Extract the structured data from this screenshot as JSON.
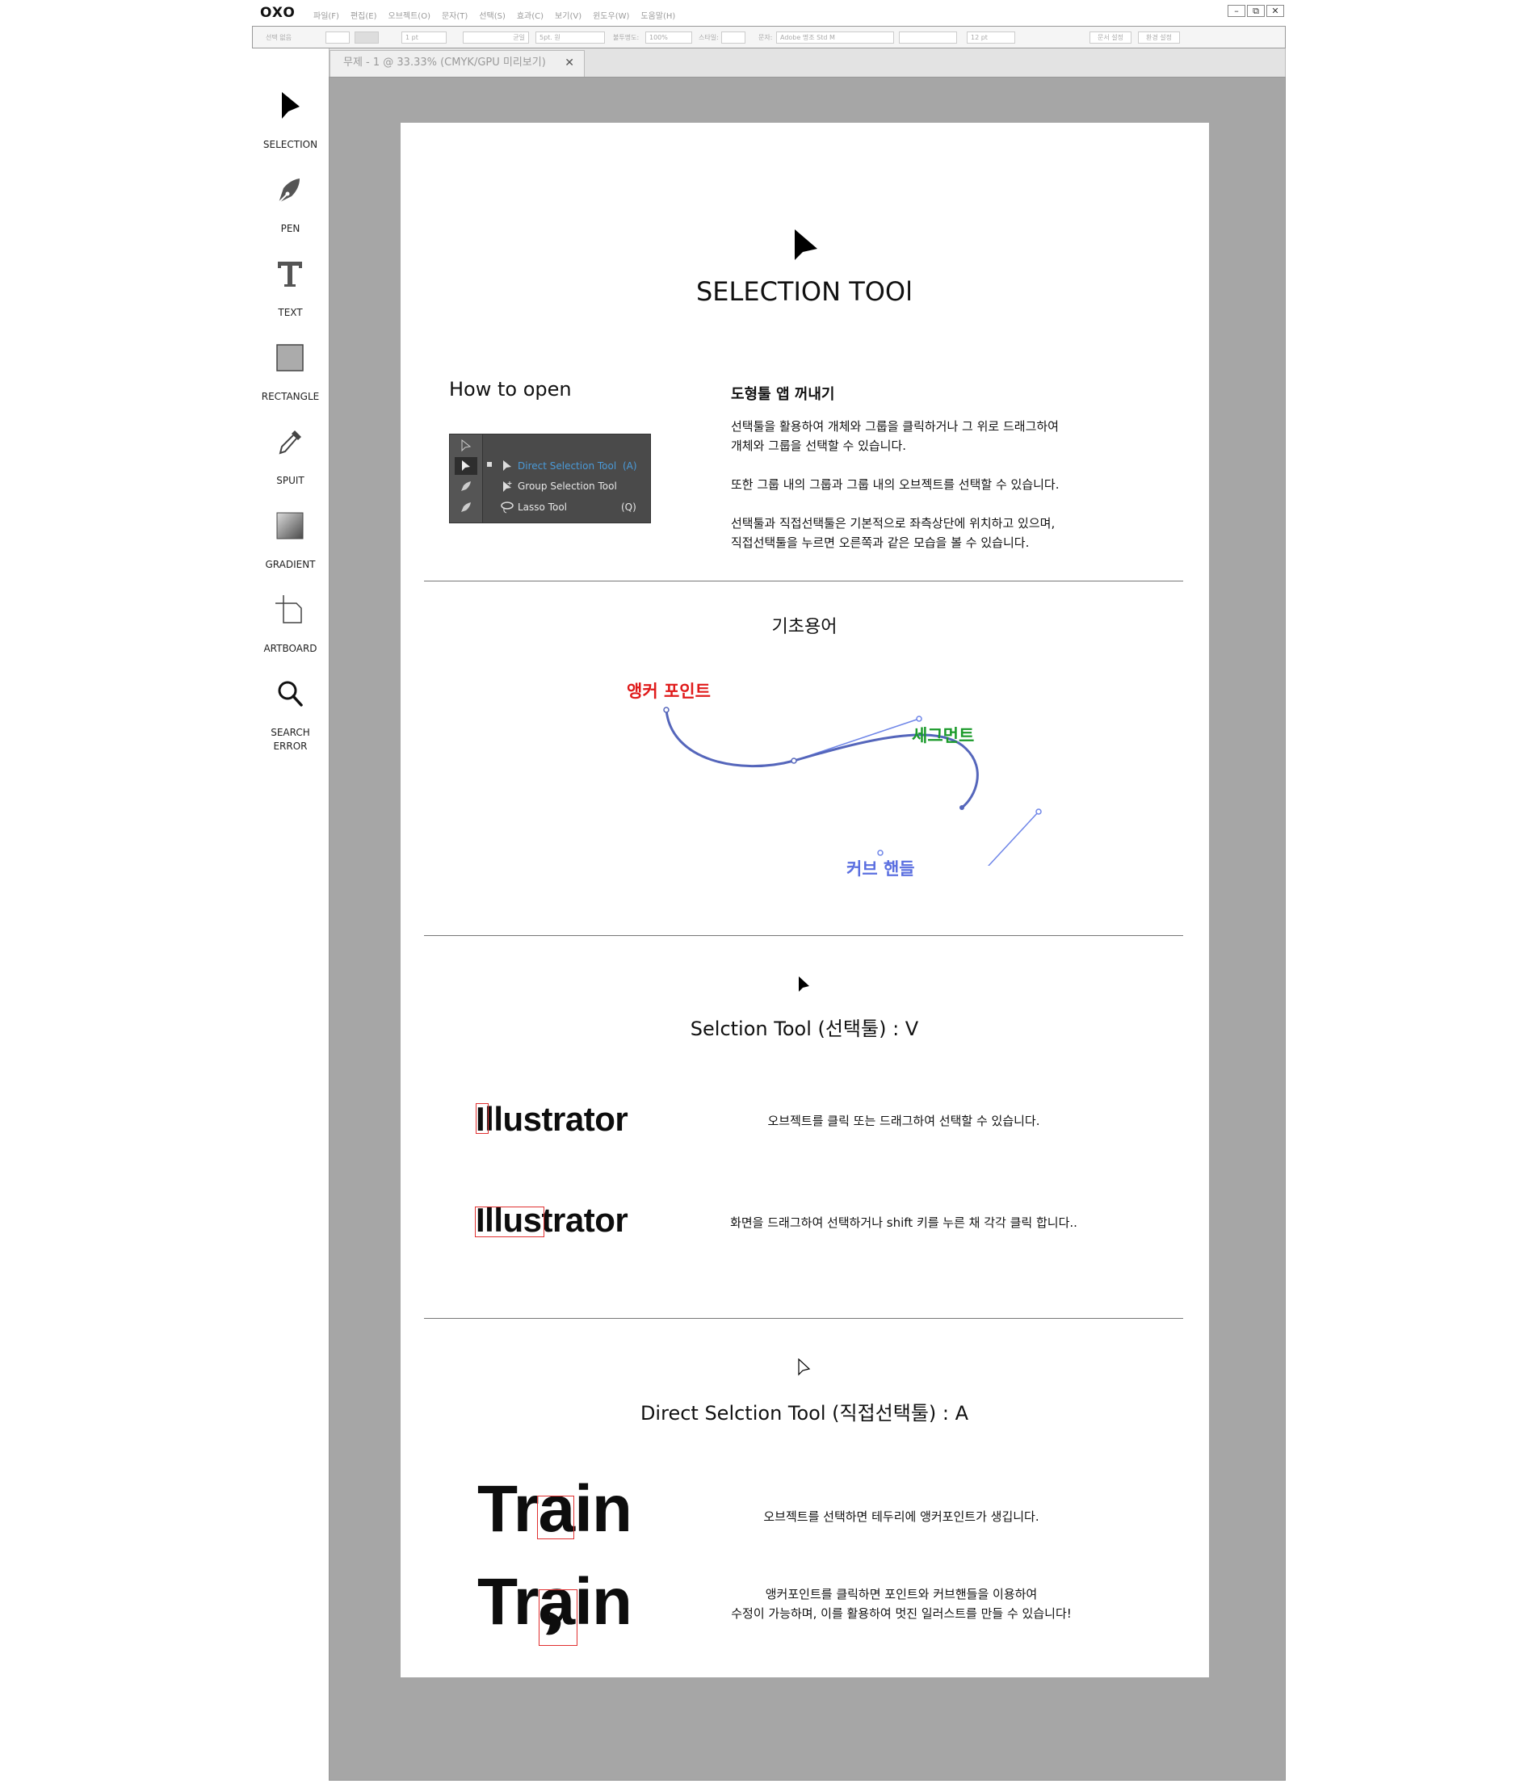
{
  "app": {
    "logo": "OXO",
    "menu": [
      "파일(F)",
      "편집(E)",
      "오브젝트(O)",
      "문자(T)",
      "선택(S)",
      "효과(C)",
      "보기(V)",
      "윈도우(W)",
      "도움말(H)"
    ],
    "window_buttons": {
      "minimize": "–",
      "restore": "⧉",
      "close": "✕"
    }
  },
  "options_bar": {
    "selection_label": "선택 없음",
    "stroke_weight": "1 pt",
    "stroke_style": "균일",
    "brush": "5pt. 원",
    "opacity_label": "불투명도:",
    "opacity": "100%",
    "style_label": "스타일:",
    "font_label": "문자:",
    "font_value": "Adobe 명조 Std M",
    "font_size": "12 pt",
    "doc_setup_button": "문서 설정",
    "prefs_button": "환경 설정"
  },
  "document_tab": {
    "title": "무제 - 1 @ 33.33% (CMYK/GPU 미리보기)",
    "close": "✕"
  },
  "tools": [
    {
      "label": "SELECTION",
      "icon": "selection-arrow-icon"
    },
    {
      "label": "PEN",
      "icon": "pen-nib-icon"
    },
    {
      "label": "TEXT",
      "icon": "text-t-icon"
    },
    {
      "label": "RECTANGLE",
      "icon": "rectangle-icon"
    },
    {
      "label": "SPUIT",
      "icon": "eyedropper-icon"
    },
    {
      "label": "GRADIENT",
      "icon": "gradient-icon"
    },
    {
      "label": "ARTBOARD",
      "icon": "artboard-icon"
    },
    {
      "label": "SEARCH",
      "label2": "ERROR",
      "icon": "magnifier-icon"
    }
  ],
  "artboard": {
    "title": "SELECTION TOOl",
    "how_to_open": {
      "heading": "How to open",
      "menu_items": [
        {
          "label": "Direct Selection Tool",
          "shortcut": "(A)"
        },
        {
          "label": "Group Selection Tool",
          "shortcut": ""
        },
        {
          "label": "Lasso Tool",
          "shortcut": "(Q)"
        }
      ],
      "subheading": "도형툴 앱 꺼내기",
      "paragraphs": [
        [
          "선택툴을 활용하여 개체와 그룹을 클릭하거나 그 위로 드래그하여",
          "개체와 그룹을 선택할 수 있습니다."
        ],
        [
          "또한 그룹 내의 그룹과 그룹 내의 오브젝트를 선택할 수 있습니다."
        ],
        [
          "선택툴과 직접선택툴은 기본적으로 좌측상단에 위치하고 있으며,",
          "직접선택툴을 누르면 오른쪽과 같은 모습을 볼 수 있습니다."
        ]
      ]
    },
    "basics": {
      "heading": "기초용어",
      "anchor_label": "앵커 포인트",
      "segment_label": "세그먼트",
      "handle_label": "커브 핸들",
      "colors": {
        "anchor": "#e01b1b",
        "segment": "#1a9a2a",
        "handle": "#5b6fe0",
        "curve": "#5566bb"
      }
    },
    "selection_tool": {
      "heading": "Selction Tool (선택툴) : V",
      "examples": [
        {
          "word": "Illustrator",
          "desc": "오브젝트를 클릭 또는 드래그하여 선택할 수 있습니다."
        },
        {
          "word": "Illustrator",
          "desc": "화면을 드래그하여 선택하거나 shift 키를 누른 채 각각 클릭 합니다.."
        }
      ]
    },
    "direct_selection_tool": {
      "heading": "Direct Selction Tool (직접선택툴) : A",
      "examples": [
        {
          "word": "Train",
          "desc": [
            "오브젝트를 선택하면 테두리에 앵커포인트가 생깁니다."
          ]
        },
        {
          "word": "Train",
          "desc": [
            "앵커포인트를 클릭하면 포인트와 커브핸들을 이용하여",
            "수정이 가능하며, 이를 활용하여 멋진 일러스트를 만들 수 있습니다!"
          ]
        }
      ]
    }
  }
}
